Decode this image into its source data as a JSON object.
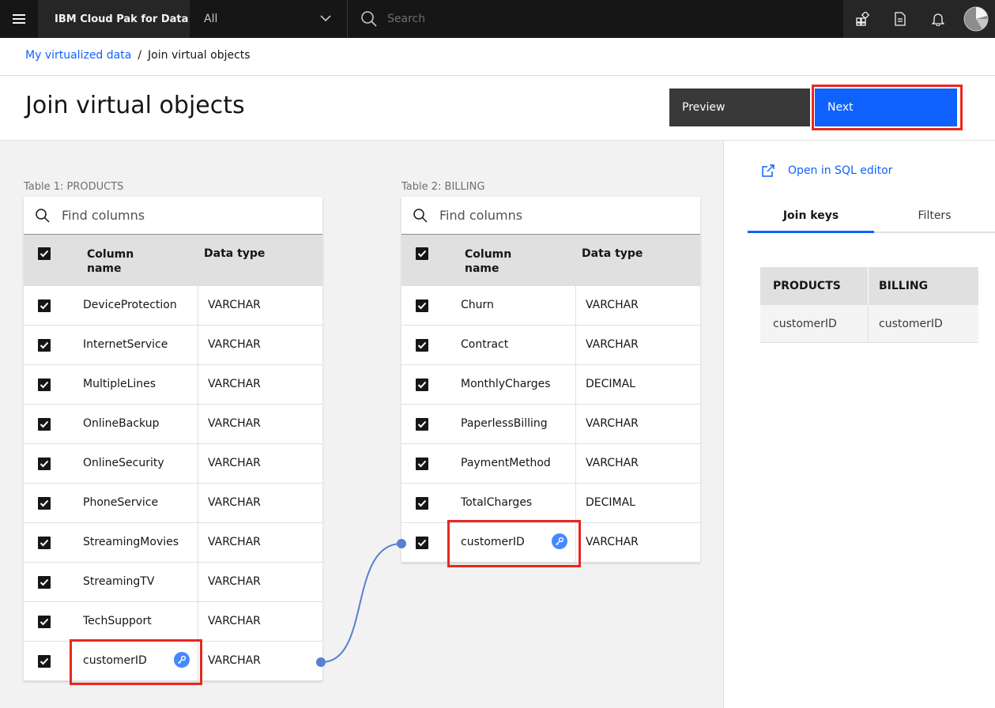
{
  "nav": {
    "brand": "IBM Cloud Pak for Data",
    "scope": "All",
    "search_placeholder": "Search"
  },
  "breadcrumb": {
    "parent": "My virtualized data",
    "separator": "/",
    "current": "Join virtual objects"
  },
  "page": {
    "title": "Join virtual objects",
    "preview_label": "Preview",
    "next_label": "Next"
  },
  "table1": {
    "label": "Table 1: PRODUCTS",
    "search_placeholder": "Find columns",
    "col_name_line1": "Column",
    "col_name_line2": "name",
    "col_type": "Data type",
    "rows": [
      {
        "name": "DeviceProtection",
        "type": "VARCHAR"
      },
      {
        "name": "InternetService",
        "type": "VARCHAR"
      },
      {
        "name": "MultipleLines",
        "type": "VARCHAR"
      },
      {
        "name": "OnlineBackup",
        "type": "VARCHAR"
      },
      {
        "name": "OnlineSecurity",
        "type": "VARCHAR"
      },
      {
        "name": "PhoneService",
        "type": "VARCHAR"
      },
      {
        "name": "StreamingMovies",
        "type": "VARCHAR"
      },
      {
        "name": "StreamingTV",
        "type": "VARCHAR"
      },
      {
        "name": "TechSupport",
        "type": "VARCHAR"
      },
      {
        "name": "customerID",
        "type": "VARCHAR"
      }
    ]
  },
  "table2": {
    "label": "Table 2: BILLING",
    "search_placeholder": "Find columns",
    "col_name_line1": "Column",
    "col_name_line2": "name",
    "col_type": "Data type",
    "rows": [
      {
        "name": "Churn",
        "type": "VARCHAR"
      },
      {
        "name": "Contract",
        "type": "VARCHAR"
      },
      {
        "name": "MonthlyCharges",
        "type": "DECIMAL"
      },
      {
        "name": "PaperlessBilling",
        "type": "VARCHAR"
      },
      {
        "name": "PaymentMethod",
        "type": "VARCHAR"
      },
      {
        "name": "TotalCharges",
        "type": "DECIMAL"
      },
      {
        "name": "customerID",
        "type": "VARCHAR"
      }
    ]
  },
  "side": {
    "sql_link": "Open in SQL editor",
    "tab_join_keys": "Join keys",
    "tab_filters": "Filters",
    "keys_head1": "PRODUCTS",
    "keys_head2": "BILLING",
    "keys_row": {
      "c1": "customerID",
      "c2": "customerID"
    }
  },
  "colors": {
    "accent": "#0f62fe",
    "highlight": "#e8281e",
    "key_badge": "#4589ff",
    "connector": "#5a7fd0"
  }
}
